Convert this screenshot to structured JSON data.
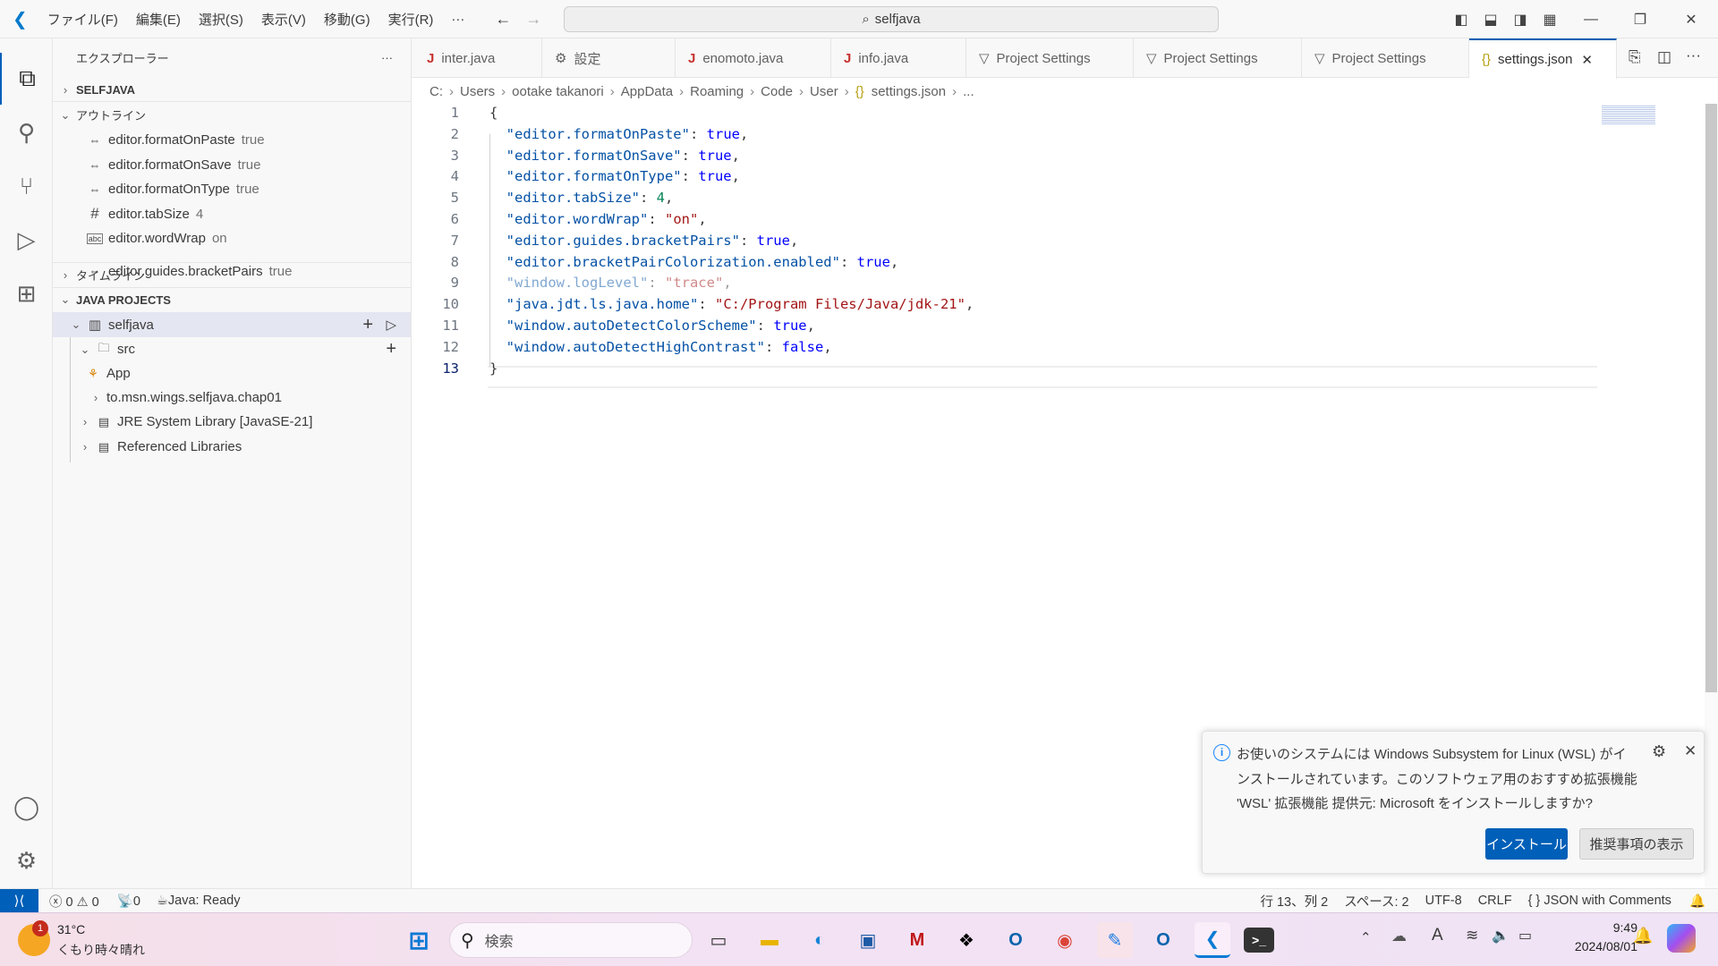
{
  "titlebar": {
    "menus": [
      "ファイル(F)",
      "編集(E)",
      "選択(S)",
      "表示(V)",
      "移動(G)",
      "実行(R)",
      "···"
    ],
    "search": "selfjava"
  },
  "sidebar": {
    "title": "エクスプローラー",
    "more": "···",
    "selfjava_section": "SELFJAVA",
    "outline_section": "アウトライン",
    "outline": [
      {
        "name": "editor.formatOnPaste",
        "value": "true"
      },
      {
        "name": "editor.formatOnSave",
        "value": "true"
      },
      {
        "name": "editor.formatOnType",
        "value": "true"
      },
      {
        "name": "editor.tabSize",
        "value": "4"
      },
      {
        "name": "editor.wordWrap",
        "value": "on"
      },
      {
        "name": "editor.guides.bracketPairs",
        "value": "true"
      }
    ],
    "timeline_section": "タイムライン",
    "java_section": "JAVA PROJECTS",
    "tree": {
      "project": "selfjava",
      "src": "src",
      "app": "App",
      "package": "to.msn.wings.selfjava.chap01",
      "jre": "JRE System Library [JavaSE-21]",
      "refs": "Referenced Libraries"
    }
  },
  "tabs": [
    {
      "label": "inter.java",
      "icon": "J"
    },
    {
      "label": "設定",
      "icon": "⚙"
    },
    {
      "label": "enomoto.java",
      "icon": "J"
    },
    {
      "label": "info.java",
      "icon": "J"
    },
    {
      "label": "Project Settings",
      "icon": "project"
    },
    {
      "label": "Project Settings",
      "icon": "project"
    },
    {
      "label": "Project Settings",
      "icon": "project"
    },
    {
      "label": "settings.json",
      "icon": "{}",
      "active": true
    }
  ],
  "breadcrumb": [
    "C:",
    "Users",
    "ootake takanori",
    "AppData",
    "Roaming",
    "Code",
    "User",
    "settings.json",
    "..."
  ],
  "editor": {
    "lines": [
      [
        "1",
        "{"
      ],
      [
        "2",
        "  \"editor.formatOnPaste\": true,"
      ],
      [
        "3",
        "  \"editor.formatOnSave\": true,"
      ],
      [
        "4",
        "  \"editor.formatOnType\": true,"
      ],
      [
        "5",
        "  \"editor.tabSize\": 4,"
      ],
      [
        "6",
        "  \"editor.wordWrap\": \"on\","
      ],
      [
        "7",
        "  \"editor.guides.bracketPairs\": true,"
      ],
      [
        "8",
        "  \"editor.bracketPairColorization.enabled\": true,"
      ],
      [
        "9",
        "  \"window.logLevel\": \"trace\","
      ],
      [
        "10",
        "  \"java.jdt.ls.java.home\": \"C:/Program Files/Java/jdk-21\","
      ],
      [
        "11",
        "  \"window.autoDetectColorScheme\": true,"
      ],
      [
        "12",
        "  \"window.autoDetectHighContrast\": false,"
      ],
      [
        "13",
        "}"
      ]
    ],
    "current_line": 13
  },
  "notification": {
    "message": "お使いのシステムには Windows Subsystem for Linux (WSL) がインストールされています。このソフトウェア用のおすすめ拡張機能 'WSL' 拡張機能 提供元: Microsoft をインストールしますか?",
    "install": "インストール",
    "show": "推奨事項の表示"
  },
  "statusbar": {
    "errors": "0",
    "warnings": "0",
    "ports": "0",
    "java": "Java: Ready",
    "position": "行 13、列 2",
    "spaces": "スペース: 2",
    "encoding": "UTF-8",
    "eol": "CRLF",
    "language": "JSON with Comments"
  },
  "taskbar": {
    "temp": "31°C",
    "weather": "くもり時々晴れ",
    "badge": "1",
    "search": "検索",
    "time": "9:49",
    "date": "2024/08/01"
  },
  "colors": {
    "accent": "#005fb8",
    "keyword": "#0000ff",
    "property": "#0451a5",
    "string": "#a31515",
    "number": "#098658"
  }
}
